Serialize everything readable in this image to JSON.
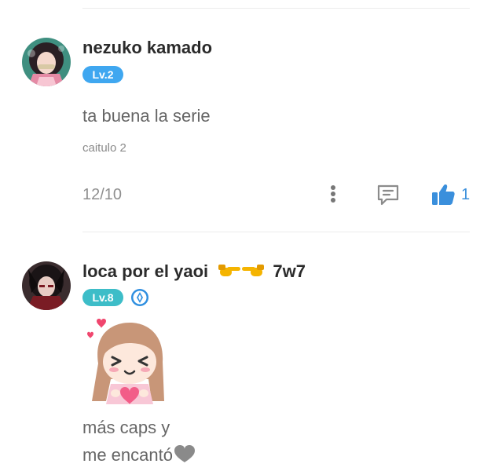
{
  "comments": [
    {
      "username": "nezuko kamado",
      "level": "Lv.2",
      "level_color": "#3fa7f0",
      "text": "ta buena la serie",
      "note": "caitulo 2",
      "date": "12/10",
      "likes": "1",
      "icons": [
        "more-vertical-icon",
        "reply-icon",
        "thumbs-up-icon"
      ]
    },
    {
      "username": "loca por el yaoi",
      "username_suffix": "7w7",
      "level": "Lv.8",
      "level_color": "#3dbdc8",
      "title_icon": "curator-badge-icon",
      "text_lines": [
        "más caps y",
        "me encantó"
      ],
      "emojis": [
        "pointing-right-icon",
        "pointing-left-icon",
        "grey-heart-icon"
      ],
      "sticker": "anime-girl-sticker"
    }
  ],
  "colors": {
    "accent_blue": "#3a8fdc",
    "icon_grey": "#8b8b8b"
  }
}
